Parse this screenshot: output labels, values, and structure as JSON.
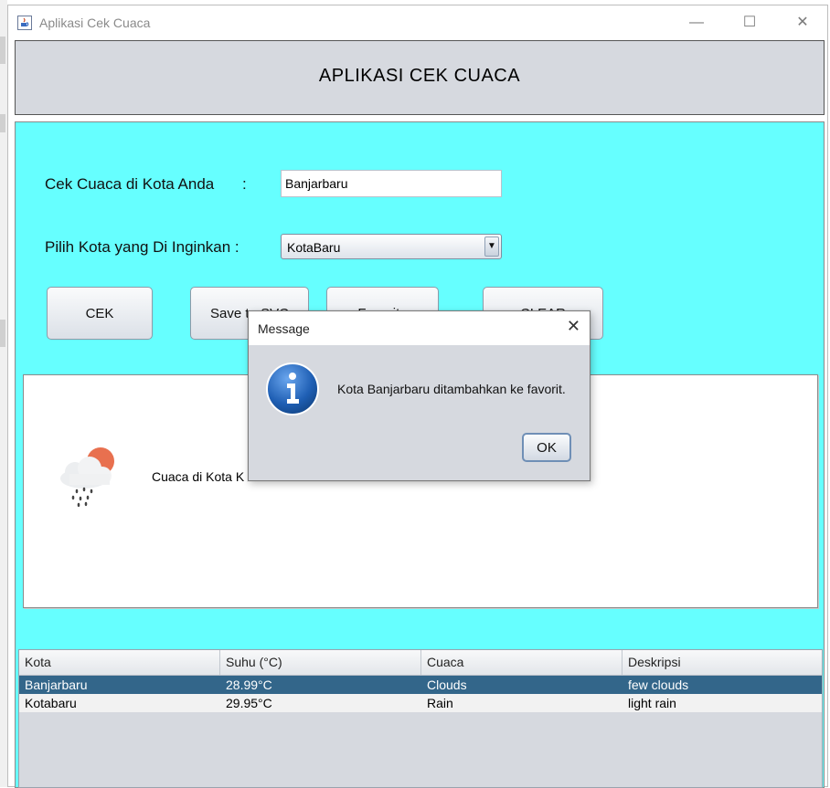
{
  "window": {
    "title": "Aplikasi Cek Cuaca",
    "minimize_glyph": "—",
    "maximize_glyph": "☐",
    "close_glyph": "✕"
  },
  "header": {
    "title": "APLIKASI CEK CUACA"
  },
  "form": {
    "city_label": "Cek Cuaca di Kota Anda",
    "city_colon": ":",
    "city_value": "Banjarbaru",
    "choose_label": "Pilih Kota yang Di Inginkan :",
    "choose_selected": "KotaBaru",
    "dropdown_glyph": "▼"
  },
  "buttons": {
    "cek": "CEK",
    "save": "Save to SVC",
    "favorite": "Favorite",
    "clear": "CLEAR"
  },
  "result": {
    "text": "Cuaca di Kota K",
    "icon": "cloud-sun-rain-icon"
  },
  "table": {
    "columns": [
      "Kota",
      "Suhu (°C)",
      "Cuaca",
      "Deskripsi"
    ],
    "rows": [
      [
        "Banjarbaru",
        "28.99°C",
        "Clouds",
        "few clouds"
      ],
      [
        "Kotabaru",
        "29.95°C",
        "Rain",
        "light rain"
      ]
    ],
    "selected_row_index": 0
  },
  "dialog": {
    "title": "Message",
    "close_glyph": "✕",
    "icon": "info-icon",
    "message": "Kota Banjarbaru ditambahkan ke favorit.",
    "ok_label": "OK"
  },
  "colors": {
    "main_background": "#66ffff",
    "header_background": "#d6d9df",
    "selected_row": "#33668a",
    "dialog_icon": "#1f5fb4"
  }
}
